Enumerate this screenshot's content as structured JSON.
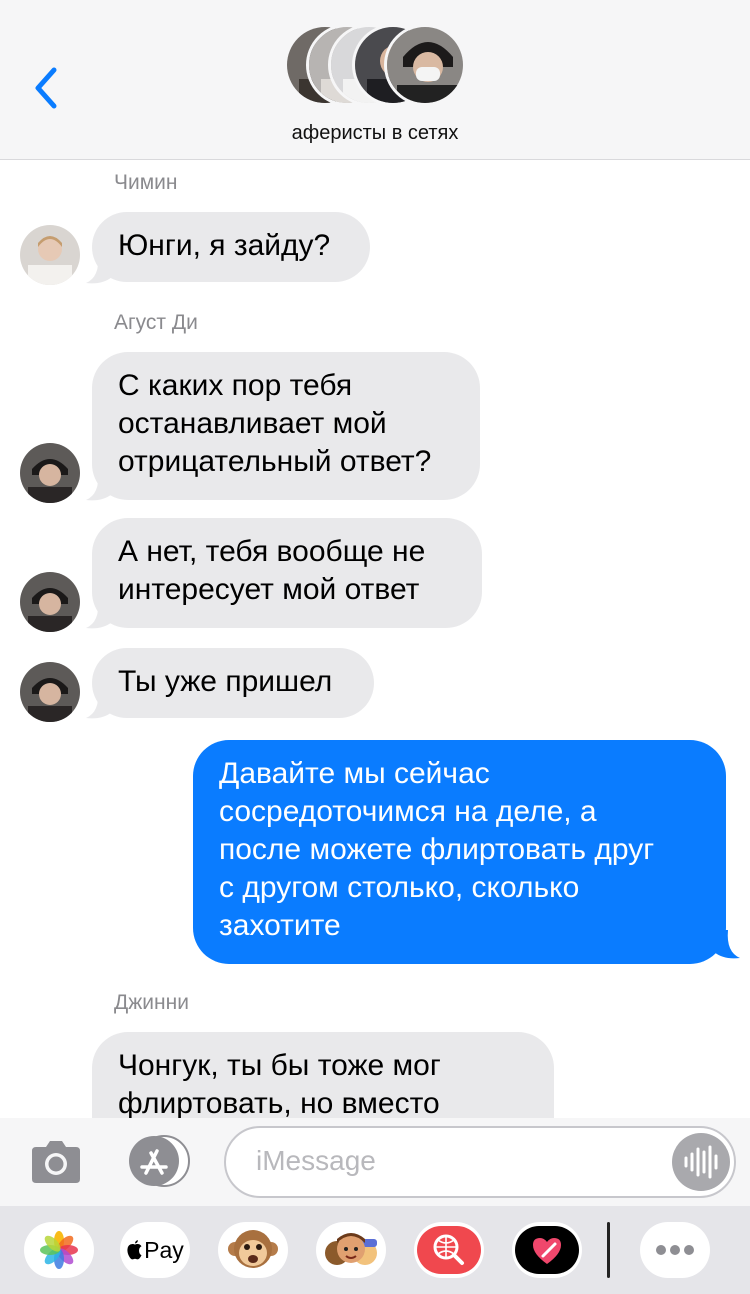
{
  "header": {
    "back_icon": "chevron-left-icon",
    "group_name": "аферисты в сетях",
    "accent": "#0a7cff"
  },
  "messages": [
    {
      "sender": "Чимин",
      "text": "Юнги, я зайду?",
      "direction": "incoming"
    },
    {
      "sender": "Агуст Ди",
      "text_lines": [
        "С каких пор тебя",
        "останавливает мой",
        "отрицательный ответ?"
      ],
      "direction": "incoming"
    },
    {
      "text_lines": [
        "А нет, тебя вообще не",
        "интересует мой ответ"
      ],
      "direction": "incoming"
    },
    {
      "text": "Ты уже пришел",
      "direction": "incoming"
    },
    {
      "text_lines": [
        "Давайте мы сейчас",
        "сосредоточимся на деле, а",
        "после можете флиртовать друг",
        "с другом столько, сколько",
        "захотите"
      ],
      "direction": "outgoing"
    },
    {
      "sender": "Джинни",
      "text_lines": [
        "Чонгук, ты бы тоже мог",
        "флиртовать, но вместо"
      ],
      "direction": "incoming"
    }
  ],
  "input": {
    "placeholder": "iMessage",
    "camera_icon": "camera-icon",
    "appstore_icon": "app-store-icon",
    "audio_icon": "audio-waveform-icon"
  },
  "apps": {
    "photos_icon": "photos-icon",
    "applepay_label": "Pay",
    "animoji_icon": "monkey-animoji-icon",
    "memoji_icon": "memoji-stickers-icon",
    "search_icon": "web-image-search-icon",
    "digital_touch_icon": "digital-touch-heart-icon",
    "more_icon": "more-dots-icon"
  },
  "colors": {
    "incoming_bubble": "#e9e9eb",
    "outgoing_bubble": "#0a7cff",
    "sender_label": "#8a8a8e"
  }
}
